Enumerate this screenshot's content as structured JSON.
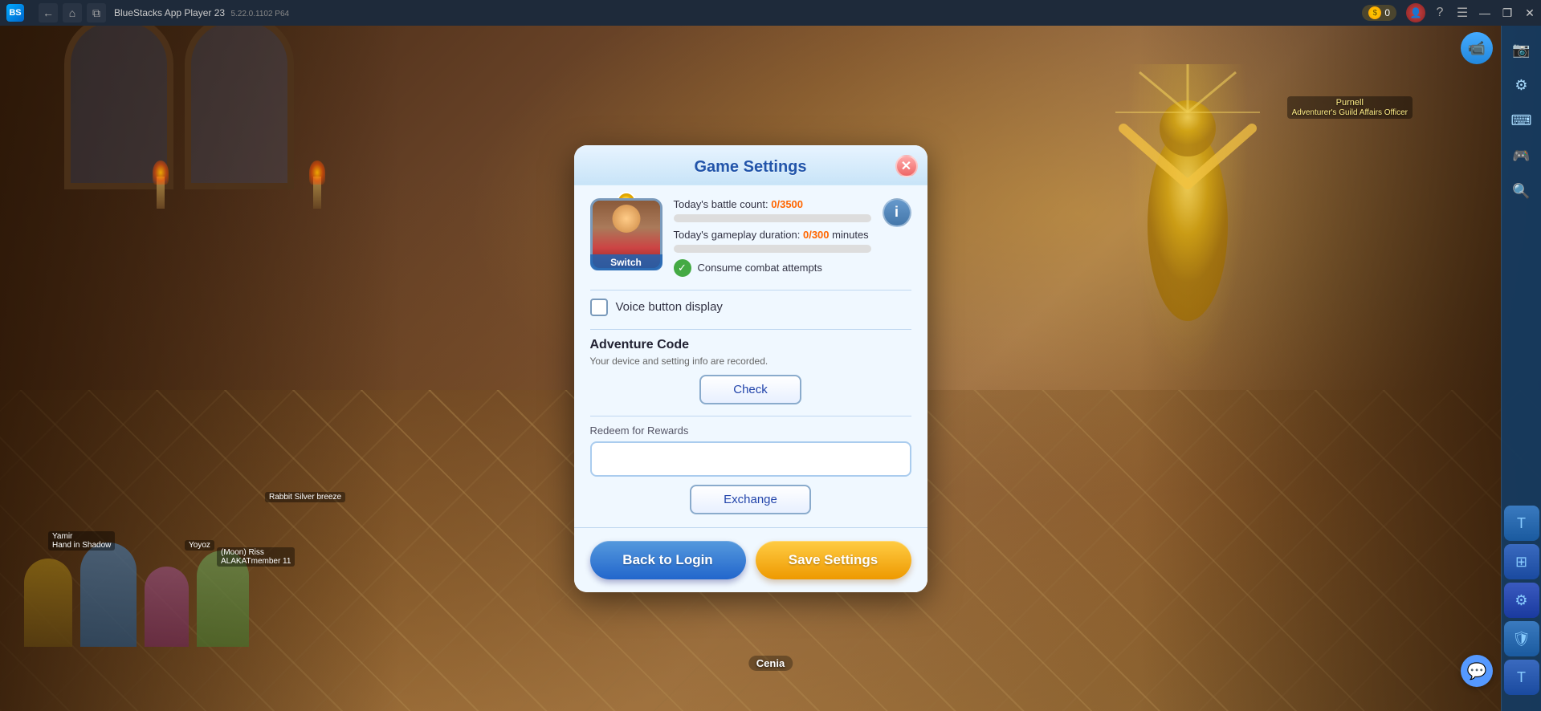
{
  "titlebar": {
    "app_name": "BlueStacks App Player 23",
    "version": "5.22.0.1102  P64",
    "logo_letter": "B",
    "back_label": "←",
    "home_label": "⌂",
    "history_label": "⧉"
  },
  "top_controls": {
    "coin_count": "0",
    "minimize_label": "—",
    "restore_label": "❐",
    "close_label": "✕"
  },
  "modal": {
    "title": "Game Settings",
    "close_label": "✕",
    "avatar_label": "Switch",
    "battle_count_label": "Today's battle count:",
    "battle_count_value": "0/3500",
    "gameplay_duration_label": "Today's gameplay duration:",
    "gameplay_duration_value": "0/300",
    "gameplay_duration_suffix": "minutes",
    "consume_label": "Consume combat attempts",
    "voice_button_label": "Voice button display",
    "adventure_code_title": "Adventure Code",
    "adventure_code_desc": "Your device and setting info are recorded.",
    "check_btn_label": "Check",
    "redeem_label": "Redeem for Rewards",
    "redeem_placeholder": "",
    "exchange_btn_label": "Exchange",
    "back_to_login_label": "Back to Login",
    "save_settings_label": "Save Settings",
    "info_symbol": "i"
  },
  "sidebar": {
    "icons": [
      "⊞",
      "⚙",
      "🛡",
      "T",
      "T"
    ]
  },
  "rpanel": {
    "icons": [
      "⊞",
      "⚙",
      "🛡",
      "T",
      "T"
    ]
  },
  "in_game": {
    "npc_name": "Purnell",
    "npc_title": "Adventurer's Guild Affairs Officer",
    "player_name1": "Yamir",
    "player_team1": "Hand in Shadow",
    "player_name2": "Yoyoz",
    "player_name3": "(Moon) Riss",
    "player_team3": "ALAKATmember 11",
    "player_name4": "Rabbit Silver breeze",
    "cenia_label": "Cenia"
  }
}
